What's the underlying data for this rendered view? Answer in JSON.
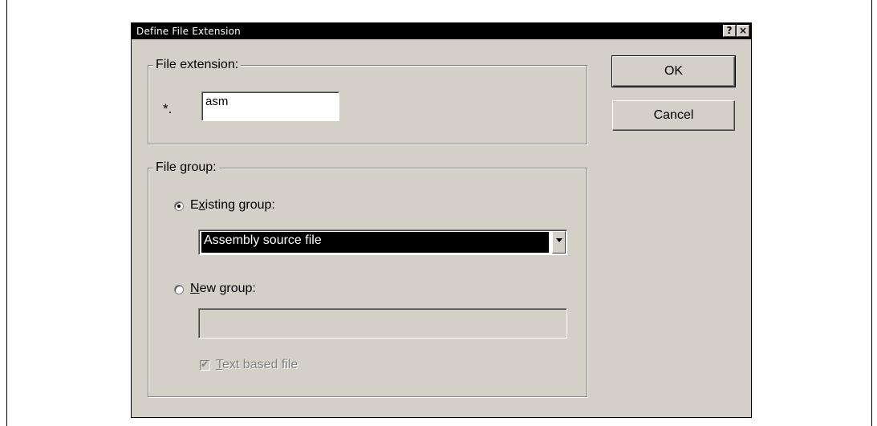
{
  "dialog": {
    "title": "Define File Extension",
    "help_glyph": "?",
    "close_glyph": "×"
  },
  "extension_group": {
    "legend": "File extension:",
    "prefix": "*.",
    "value": "asm"
  },
  "file_group": {
    "legend": "File group:",
    "existing": {
      "label_pre": "E",
      "label_accel": "x",
      "label_post": "isting group:",
      "selected": true,
      "combo_value": "Assembly source file"
    },
    "new": {
      "label_accel": "N",
      "label_post": "ew group:",
      "selected": false,
      "value": ""
    },
    "text_based": {
      "label_accel": "T",
      "label_post": "ext based file",
      "checked": true,
      "enabled": false
    }
  },
  "buttons": {
    "ok": "OK",
    "cancel": "Cancel"
  }
}
